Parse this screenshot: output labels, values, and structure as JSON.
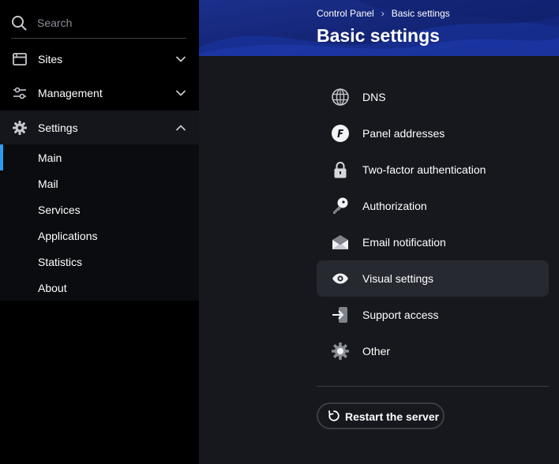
{
  "search": {
    "placeholder": "Search",
    "icon": "search-icon"
  },
  "sidebar": {
    "items": [
      {
        "label": "Sites",
        "icon": "window-icon",
        "expanded": false
      },
      {
        "label": "Management",
        "icon": "sliders-icon",
        "expanded": false
      },
      {
        "label": "Settings",
        "icon": "gear-icon",
        "expanded": true
      }
    ],
    "submenu": [
      {
        "label": "Main",
        "current": true
      },
      {
        "label": "Mail"
      },
      {
        "label": "Services"
      },
      {
        "label": "Applications"
      },
      {
        "label": "Statistics"
      },
      {
        "label": "About"
      }
    ]
  },
  "header": {
    "breadcrumb": [
      "Control Panel",
      "Basic settings"
    ],
    "breadcrumb_separator": "›",
    "title": "Basic settings"
  },
  "settings_list": [
    {
      "label": "DNS",
      "icon": "globe-icon"
    },
    {
      "label": "Panel addresses",
      "icon": "panel-f-icon"
    },
    {
      "label": "Two-factor authentication",
      "icon": "lock-icon"
    },
    {
      "label": "Authorization",
      "icon": "key-icon"
    },
    {
      "label": "Email notification",
      "icon": "envelope-icon"
    },
    {
      "label": "Visual settings",
      "icon": "eye-icon",
      "selected": true
    },
    {
      "label": "Support access",
      "icon": "sign-in-icon"
    },
    {
      "label": "Other",
      "icon": "gear-icon"
    }
  ],
  "actions": {
    "restart_label": "Restart the server",
    "restart_icon": "refresh-icon"
  },
  "colors": {
    "accent": "#2f9bf0",
    "header_bg": "#172a80",
    "main_bg": "#16181d",
    "selected_row": "#262930"
  }
}
